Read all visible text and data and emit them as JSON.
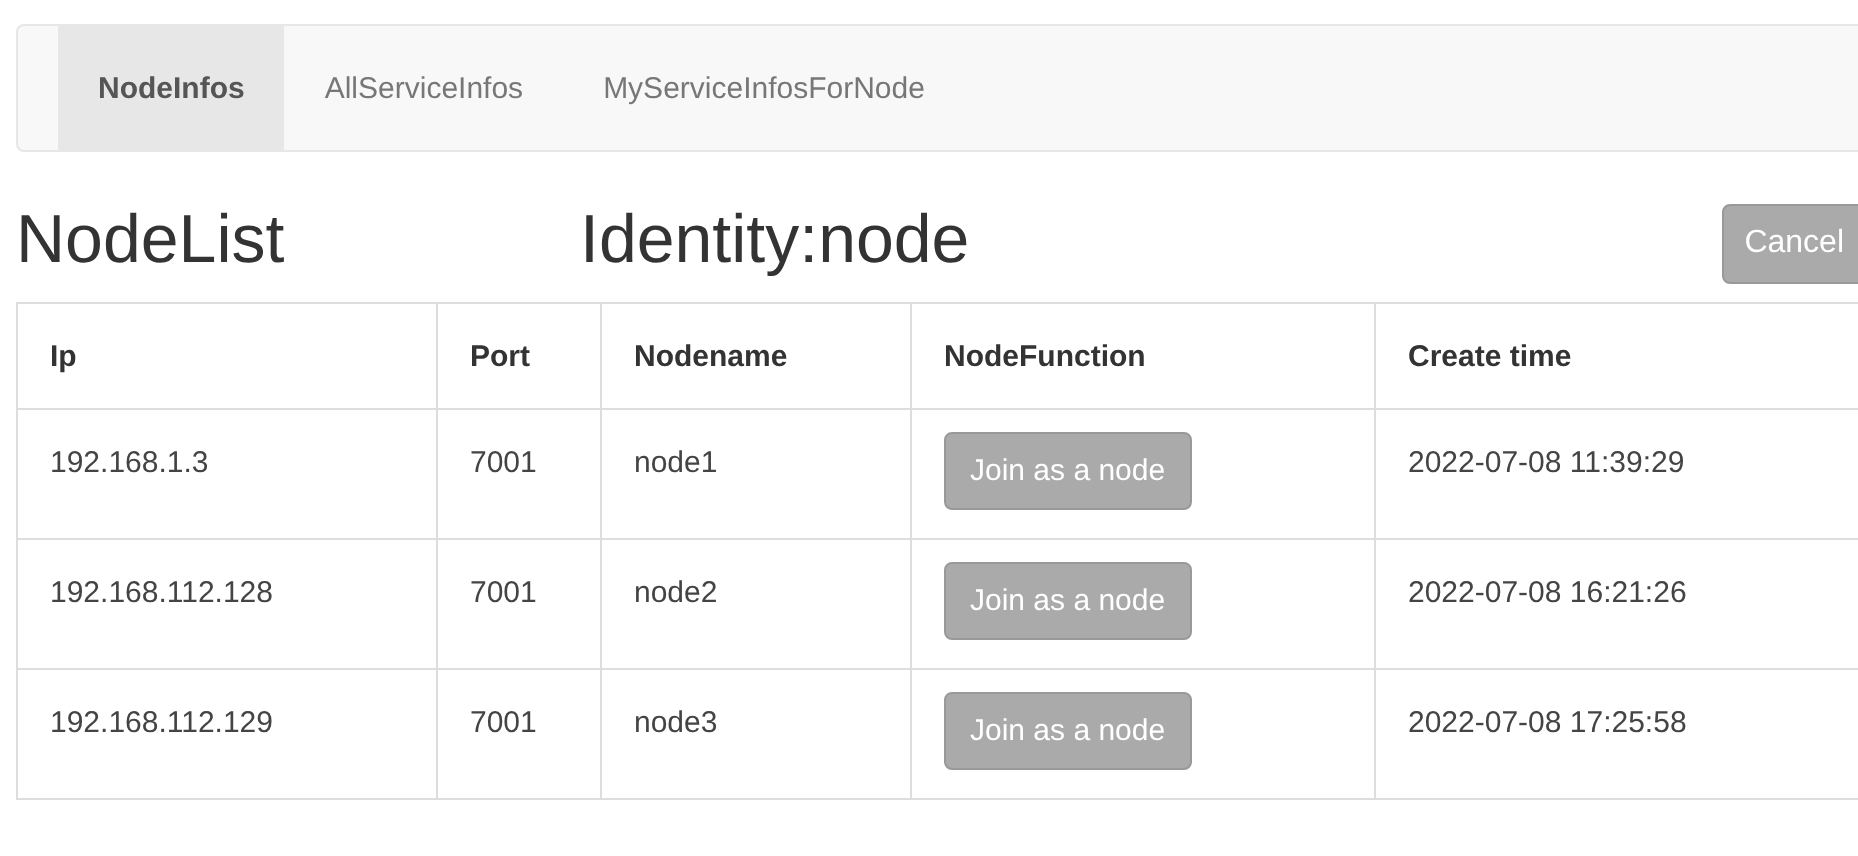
{
  "tabs": [
    {
      "label": "NodeInfos",
      "selected": true
    },
    {
      "label": "AllServiceInfos",
      "selected": false
    },
    {
      "label": "MyServiceInfosForNode",
      "selected": false
    }
  ],
  "cancel_button": "Cancel",
  "title": "NodeList",
  "identity": "Identity:node",
  "table": {
    "columns": [
      "Ip",
      "Port",
      "Nodename",
      "NodeFunction",
      "Create time"
    ],
    "rows": [
      {
        "ip": "192.168.1.3",
        "port": "7001",
        "nodename": "node1",
        "action": "Join as a node",
        "created": "2022-07-08 11:39:29"
      },
      {
        "ip": "192.168.112.128",
        "port": "7001",
        "nodename": "node2",
        "action": "Join as a node",
        "created": "2022-07-08 16:21:26"
      },
      {
        "ip": "192.168.112.129",
        "port": "7001",
        "nodename": "node3",
        "action": "Join as a node",
        "created": "2022-07-08 17:25:58"
      }
    ]
  }
}
